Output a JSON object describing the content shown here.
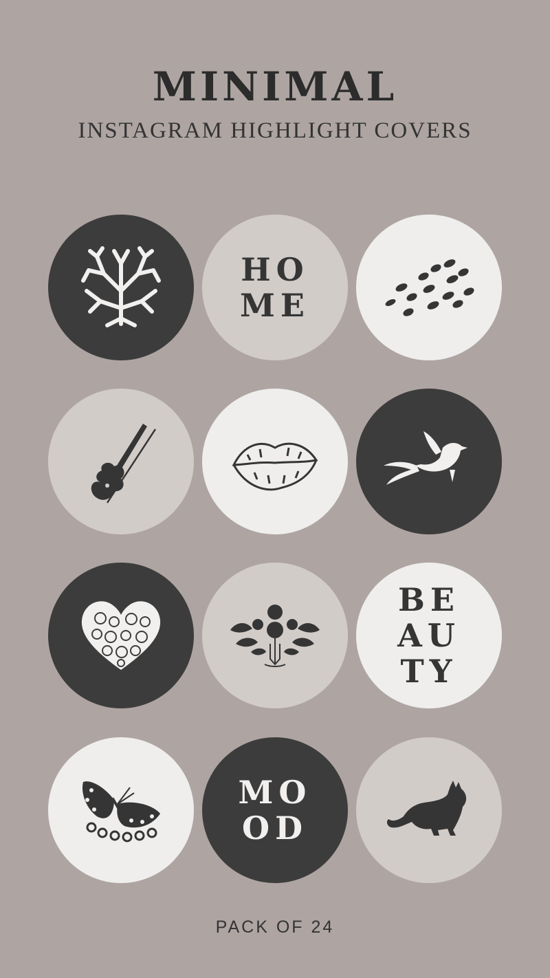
{
  "header": {
    "title": "MINIMAL",
    "subtitle": "INSTAGRAM HIGHLIGHT COVERS"
  },
  "covers": [
    {
      "icon": "coral-tree-icon",
      "style": "dark"
    },
    {
      "lines": [
        "HO",
        "ME"
      ],
      "style": "taupe"
    },
    {
      "icon": "brush-dots-icon",
      "style": "white"
    },
    {
      "icon": "violin-icon",
      "style": "taupe"
    },
    {
      "icon": "lips-icon",
      "style": "white"
    },
    {
      "icon": "bird-icon",
      "style": "dark"
    },
    {
      "icon": "heart-icon",
      "style": "dark"
    },
    {
      "icon": "flower-bouquet-icon",
      "style": "taupe"
    },
    {
      "lines": [
        "BE",
        "AU",
        "TY"
      ],
      "style": "white"
    },
    {
      "icon": "butterfly-icon",
      "style": "white"
    },
    {
      "lines": [
        "MO",
        "OD"
      ],
      "style": "dark"
    },
    {
      "icon": "cat-icon",
      "style": "taupe"
    }
  ],
  "footer": {
    "text": "PACK OF 24"
  },
  "colors": {
    "background": "#aea5a3",
    "dark": "#3c3c3c",
    "taupe": "#d2ccc9",
    "white": "#efeeed"
  }
}
